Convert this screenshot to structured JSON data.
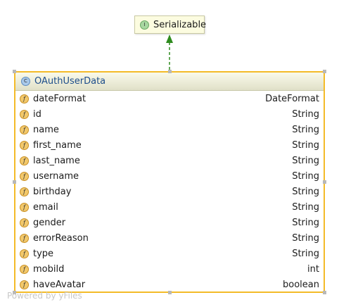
{
  "interface": {
    "badge": "I",
    "name": "Serializable",
    "badge_color": "#a8d7a0"
  },
  "class": {
    "badge": "C",
    "name": "OAuthUserData",
    "border_color": "#f4bb28",
    "field_badge": "f",
    "fields": [
      {
        "name": "dateFormat",
        "type": "DateFormat",
        "static": true
      },
      {
        "name": "id",
        "type": "String"
      },
      {
        "name": "name",
        "type": "String"
      },
      {
        "name": "first_name",
        "type": "String"
      },
      {
        "name": "last_name",
        "type": "String"
      },
      {
        "name": "username",
        "type": "String"
      },
      {
        "name": "birthday",
        "type": "String"
      },
      {
        "name": "email",
        "type": "String"
      },
      {
        "name": "gender",
        "type": "String"
      },
      {
        "name": "errorReason",
        "type": "String"
      },
      {
        "name": "type",
        "type": "String"
      },
      {
        "name": "mobild",
        "type": "int"
      },
      {
        "name": "haveAvatar",
        "type": "boolean"
      }
    ]
  },
  "edge": {
    "type": "implements",
    "color": "#2e8b1e",
    "style": "dashed"
  },
  "watermark": "Powered by yFiles"
}
